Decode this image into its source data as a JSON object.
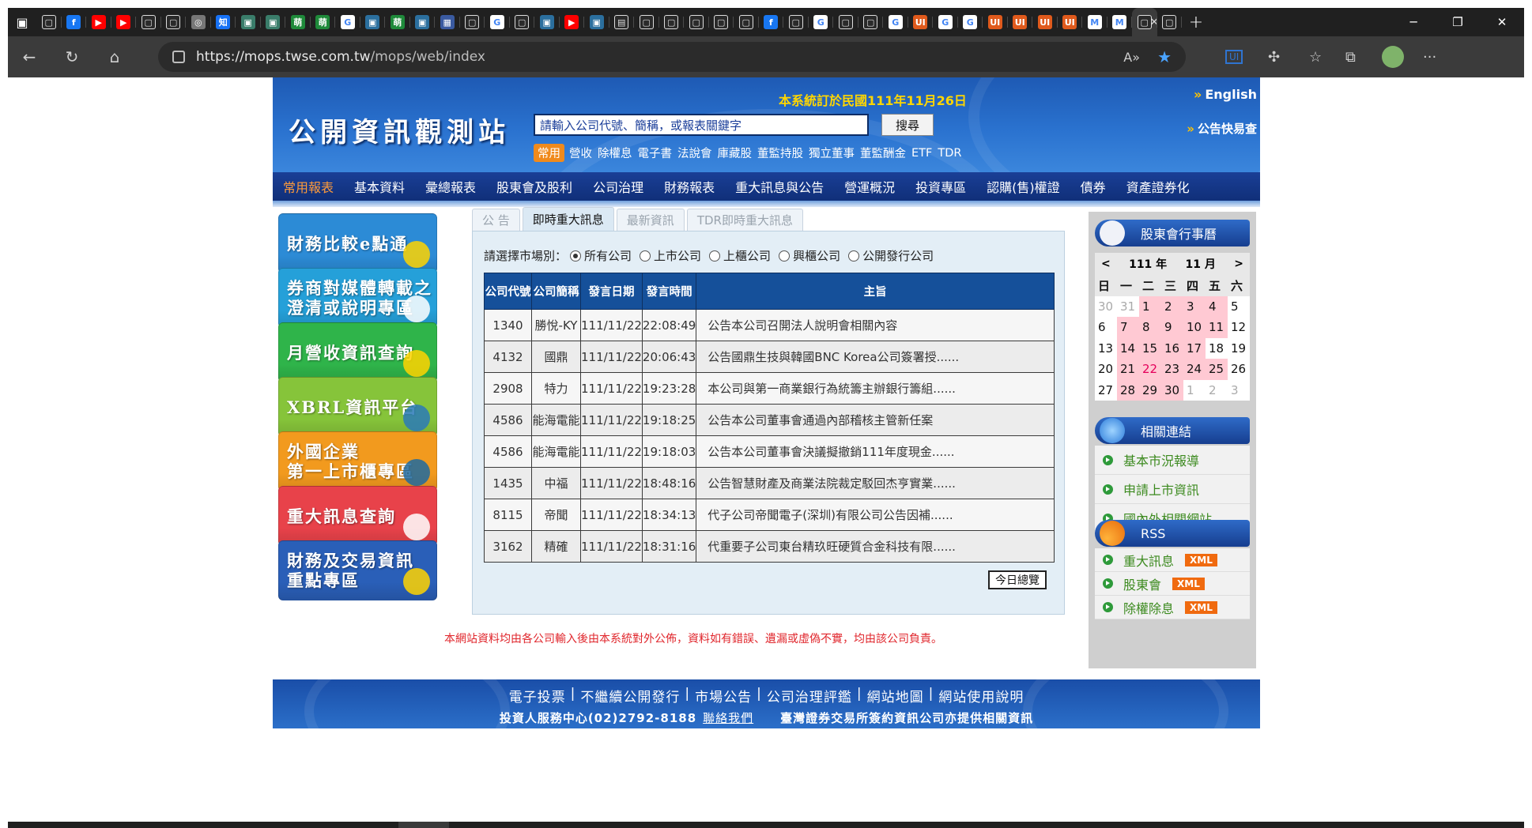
{
  "browser": {
    "url_host": "https://mops.twse.com.tw",
    "url_path": "/mops/web/index",
    "tabs": [
      {
        "icon": "page-icon",
        "color": "#2a2a2a",
        "glyph": "▢"
      },
      {
        "icon": "facebook-icon",
        "color": "#1877f2",
        "glyph": "f"
      },
      {
        "icon": "youtube-icon",
        "color": "#ff0000",
        "glyph": "▶"
      },
      {
        "icon": "youtube-icon",
        "color": "#ff0000",
        "glyph": "▶"
      },
      {
        "icon": "page-icon",
        "color": "#2a2a2a",
        "glyph": "▢"
      },
      {
        "icon": "page-icon",
        "color": "#2a2a2a",
        "glyph": "▢"
      },
      {
        "icon": "chrome-icon",
        "color": "#777777",
        "glyph": "◎"
      },
      {
        "icon": "zhihu-icon",
        "color": "#1772f6",
        "glyph": "知"
      },
      {
        "icon": "app-icon",
        "color": "#3a7d6a",
        "glyph": "▣"
      },
      {
        "icon": "app-icon",
        "color": "#3a7d6a",
        "glyph": "▣"
      },
      {
        "icon": "sprout-icon",
        "color": "#1f8a3a",
        "glyph": "萌"
      },
      {
        "icon": "sprout-icon",
        "color": "#1f8a3a",
        "glyph": "萌"
      },
      {
        "icon": "google-icon",
        "color": "#ffffff",
        "glyph": "G"
      },
      {
        "icon": "app-icon",
        "color": "#2b6f9e",
        "glyph": "▣"
      },
      {
        "icon": "sprout-icon",
        "color": "#1f8a3a",
        "glyph": "萌"
      },
      {
        "icon": "app-icon",
        "color": "#2b6f9e",
        "glyph": "▣"
      },
      {
        "icon": "grid-icon",
        "color": "#3a5aa0",
        "glyph": "▦"
      },
      {
        "icon": "page-icon",
        "color": "#2a2a2a",
        "glyph": "▢"
      },
      {
        "icon": "google-icon",
        "color": "#ffffff",
        "glyph": "G"
      },
      {
        "icon": "page-icon",
        "color": "#2a2a2a",
        "glyph": "▢"
      },
      {
        "icon": "app-icon",
        "color": "#2b6f9e",
        "glyph": "▣"
      },
      {
        "icon": "youtube-icon",
        "color": "#ff0000",
        "glyph": "▶"
      },
      {
        "icon": "app-icon",
        "color": "#2b6f9e",
        "glyph": "▣"
      },
      {
        "icon": "calendar-icon",
        "color": "#2a2a2a",
        "glyph": "▤"
      },
      {
        "icon": "page-icon",
        "color": "#2a2a2a",
        "glyph": "▢"
      },
      {
        "icon": "page-icon",
        "color": "#2a2a2a",
        "glyph": "▢"
      },
      {
        "icon": "page-icon",
        "color": "#2a2a2a",
        "glyph": "▢"
      },
      {
        "icon": "page-icon",
        "color": "#2a2a2a",
        "glyph": "▢"
      },
      {
        "icon": "page-icon",
        "color": "#2a2a2a",
        "glyph": "▢"
      },
      {
        "icon": "facebook-icon",
        "color": "#1877f2",
        "glyph": "f"
      },
      {
        "icon": "page-icon",
        "color": "#2a2a2a",
        "glyph": "▢"
      },
      {
        "icon": "google-icon",
        "color": "#ffffff",
        "glyph": "G"
      },
      {
        "icon": "page-icon",
        "color": "#2a2a2a",
        "glyph": "▢"
      },
      {
        "icon": "page-icon",
        "color": "#2a2a2a",
        "glyph": "▢"
      },
      {
        "icon": "google-icon",
        "color": "#ffffff",
        "glyph": "G"
      },
      {
        "icon": "ui-icon",
        "color": "#e05a1c",
        "glyph": "UI"
      },
      {
        "icon": "google-icon",
        "color": "#ffffff",
        "glyph": "G"
      },
      {
        "icon": "google-icon",
        "color": "#ffffff",
        "glyph": "G"
      },
      {
        "icon": "ui-icon",
        "color": "#e05a1c",
        "glyph": "UI"
      },
      {
        "icon": "ui-icon",
        "color": "#e05a1c",
        "glyph": "UI"
      },
      {
        "icon": "ui-icon",
        "color": "#e05a1c",
        "glyph": "UI"
      },
      {
        "icon": "ui-icon",
        "color": "#e05a1c",
        "glyph": "UI"
      },
      {
        "icon": "gmail-icon",
        "color": "#ffffff",
        "glyph": "M"
      },
      {
        "icon": "gmail-icon",
        "color": "#ffffff",
        "glyph": "M"
      },
      {
        "icon": "page-icon",
        "color": "#2a2a2a",
        "glyph": "▢",
        "active": true
      },
      {
        "icon": "page-icon",
        "color": "#2a2a2a",
        "glyph": "▢"
      }
    ]
  },
  "site": {
    "title": "公開資訊觀測站",
    "sys_date": "本系統訂於民國111年11月26日",
    "english": "English",
    "quick_announce": "公告快易查",
    "search": {
      "value": "請輸入公司代號、簡稱，或報表關鍵字",
      "button": "搜尋"
    },
    "common_tag": "常用",
    "common_links": [
      "營收",
      "除權息",
      "電子書",
      "法說會",
      "庫藏股",
      "董監持股",
      "獨立董事",
      "董監酬金",
      "ETF",
      "TDR"
    ],
    "nav": [
      "常用報表",
      "基本資料",
      "彙總報表",
      "股東會及股利",
      "公司治理",
      "財務報表",
      "重大訊息與公告",
      "營運概況",
      "投資專區",
      "認購(售)權證",
      "債券",
      "資產證券化"
    ],
    "banners": [
      {
        "lines": [
          "財務比較e點通"
        ],
        "bg": "#2c8bd6",
        "accent": "#ffd400"
      },
      {
        "lines": [
          "券商對媒體轉載之",
          "澄清或說明專區"
        ],
        "bg": "#25a0d9",
        "accent": "#ffffff"
      },
      {
        "lines": [
          "月營收資訊查詢"
        ],
        "bg": "#2fb44a",
        "accent": "#ffd400"
      },
      {
        "lines": [
          "XBRL資訊平台"
        ],
        "bg": "#86c43a",
        "accent": "#2a7ab8"
      },
      {
        "lines": [
          "外國企業",
          "第一上市櫃專區"
        ],
        "bg": "#f29a1e",
        "accent": "#1e6aa0"
      },
      {
        "lines": [
          "重大訊息查詢"
        ],
        "bg": "#e8424a",
        "accent": "#ffffff"
      },
      {
        "lines": [
          "財務及交易資訊",
          "重點專區"
        ],
        "bg": "#2a5fb8",
        "accent": "#ffd400"
      }
    ],
    "tabs": [
      "公 告",
      "即時重大訊息",
      "最新資訊",
      "TDR即時重大訊息"
    ],
    "market_label": "請選擇市場別：",
    "markets": [
      "所有公司",
      "上市公司",
      "上櫃公司",
      "興櫃公司",
      "公開發行公司"
    ],
    "table": {
      "headers": [
        "公司代號",
        "公司簡稱",
        "發言日期",
        "發言時間",
        "主旨"
      ],
      "rows": [
        [
          "1340",
          "勝悅-KY",
          "111/11/22",
          "22:08:49",
          "公告本公司召開法人說明會相關內容"
        ],
        [
          "4132",
          "國鼎",
          "111/11/22",
          "20:06:43",
          "公告國鼎生技與韓國BNC Korea公司簽署授......"
        ],
        [
          "2908",
          "特力",
          "111/11/22",
          "19:23:28",
          "本公司與第一商業銀行為統籌主辦銀行籌組......"
        ],
        [
          "4586",
          "能海電能",
          "111/11/22",
          "19:18:25",
          "公告本公司董事會通過內部稽核主管新任案"
        ],
        [
          "4586",
          "能海電能",
          "111/11/22",
          "19:18:03",
          "公告本公司董事會決議擬撤銷111年度現金......"
        ],
        [
          "1435",
          "中福",
          "111/11/22",
          "18:48:16",
          "公告智慧財產及商業法院裁定駁回杰亨實業......"
        ],
        [
          "8115",
          "帝聞",
          "111/11/22",
          "18:34:13",
          "代子公司帝聞電子(深圳)有限公司公告因補......"
        ],
        [
          "3162",
          "精確",
          "111/11/22",
          "18:31:16",
          "代重要子公司東台精玖旺硬質合金科技有限......"
        ]
      ]
    },
    "today_button": "今日總覽",
    "disclaimer": "本網站資料均由各公司輸入後由本系統對外公佈，資料如有錯誤、遺漏或虛偽不實，均由該公司負責。",
    "calendar": {
      "title": "股東會行事曆",
      "year_label": "111 年",
      "month_label": "11 月",
      "weekdays": [
        "日",
        "一",
        "二",
        "三",
        "四",
        "五",
        "六"
      ],
      "days": [
        {
          "d": "30",
          "other": true
        },
        {
          "d": "31",
          "other": true
        },
        {
          "d": "1",
          "mtg": true
        },
        {
          "d": "2",
          "mtg": true
        },
        {
          "d": "3",
          "mtg": true
        },
        {
          "d": "4",
          "mtg": true
        },
        {
          "d": "5"
        },
        {
          "d": "6"
        },
        {
          "d": "7",
          "mtg": true
        },
        {
          "d": "8",
          "mtg": true
        },
        {
          "d": "9",
          "mtg": true
        },
        {
          "d": "10",
          "mtg": true
        },
        {
          "d": "11",
          "mtg": true
        },
        {
          "d": "12"
        },
        {
          "d": "13"
        },
        {
          "d": "14",
          "mtg": true
        },
        {
          "d": "15",
          "mtg": true
        },
        {
          "d": "16",
          "mtg": true
        },
        {
          "d": "17",
          "mtg": true
        },
        {
          "d": "18"
        },
        {
          "d": "19"
        },
        {
          "d": "20"
        },
        {
          "d": "21",
          "mtg": true
        },
        {
          "d": "22",
          "mtg": true,
          "holiday": true
        },
        {
          "d": "23",
          "mtg": true
        },
        {
          "d": "24",
          "mtg": true
        },
        {
          "d": "25",
          "mtg": true
        },
        {
          "d": "26"
        },
        {
          "d": "27"
        },
        {
          "d": "28",
          "mtg": true
        },
        {
          "d": "29",
          "mtg": true
        },
        {
          "d": "30",
          "mtg": true
        },
        {
          "d": "1",
          "other": true
        },
        {
          "d": "2",
          "other": true
        },
        {
          "d": "3",
          "other": true
        }
      ]
    },
    "related": {
      "title": "相關連結",
      "links": [
        "基本市況報導",
        "申請上市資訊",
        "國內外相關網站"
      ]
    },
    "rss": {
      "title": "RSS",
      "links": [
        "重大訊息",
        "股東會",
        "除權除息"
      ],
      "badge": "XML"
    },
    "footer": {
      "links": [
        "電子投票",
        "不繼續公開發行",
        "市場公告",
        "公司治理評鑑",
        "網站地圖",
        "網站使用說明"
      ],
      "hotline": "投資人服務中心(02)2792-8188",
      "contact": "聯絡我們",
      "partner": "臺灣證券交易所簽約資訊公司亦提供相關資訊"
    }
  }
}
